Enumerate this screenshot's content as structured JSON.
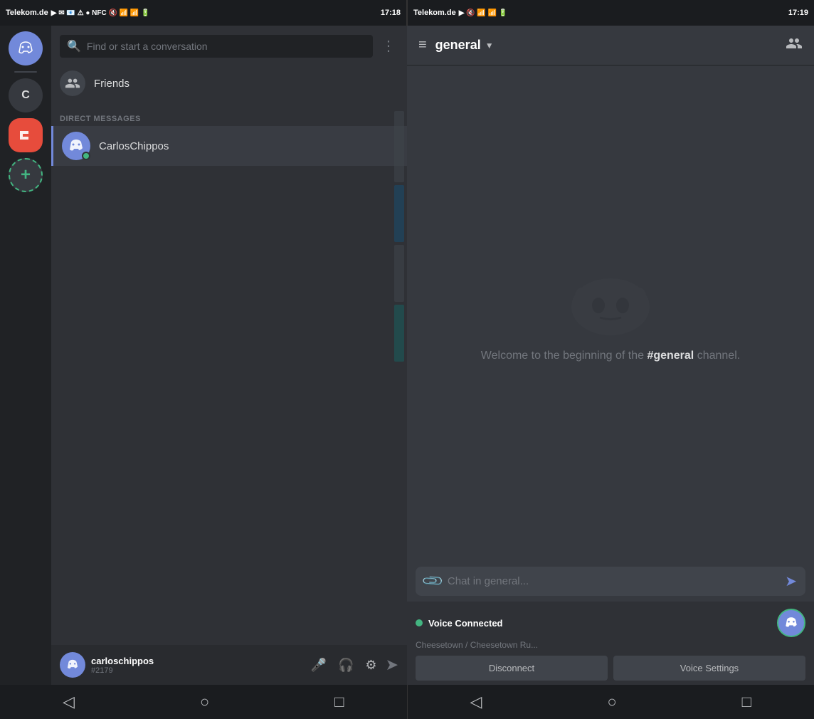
{
  "leftStatus": {
    "carrier": "Telekom.de",
    "time": "17:18",
    "icons": [
      "4G",
      "wifi",
      "battery"
    ]
  },
  "rightStatus": {
    "carrier": "Telekom.de",
    "time": "17:19"
  },
  "serverSidebar": {
    "servers": [
      {
        "id": "discord-home",
        "type": "home",
        "label": "Discord Home"
      },
      {
        "id": "c-server",
        "letter": "C",
        "label": "C Server"
      },
      {
        "id": "red-server",
        "type": "red",
        "letter": "C",
        "label": "Red Server"
      },
      {
        "id": "add-server",
        "type": "add",
        "label": "Add Server"
      }
    ]
  },
  "dmPanel": {
    "searchPlaceholder": "Find or start a conversation",
    "friendsLabel": "Friends",
    "directMessagesHeader": "DIRECT MESSAGES",
    "directMessages": [
      {
        "name": "CarlosChippos",
        "status": "online"
      }
    ]
  },
  "userBar": {
    "username": "carloschippos",
    "discriminator": "#2179"
  },
  "channelHeader": {
    "channelName": "general",
    "membersIcon": "members-icon"
  },
  "chatArea": {
    "welcomeText": "Welcome to the beginning of the ",
    "channelBold": "#general",
    "welcomeSuffix": " channel."
  },
  "chatInput": {
    "placeholder": "Chat in general..."
  },
  "voiceBar": {
    "statusLabel": "Voice Connected",
    "channelInfo": "Cheesetown / Cheesetown Ru...",
    "disconnectLabel": "Disconnect",
    "voiceSettingsLabel": "Voice Settings"
  },
  "nav": {
    "backLabel": "◁",
    "homeLabel": "○",
    "recentLabel": "□"
  }
}
